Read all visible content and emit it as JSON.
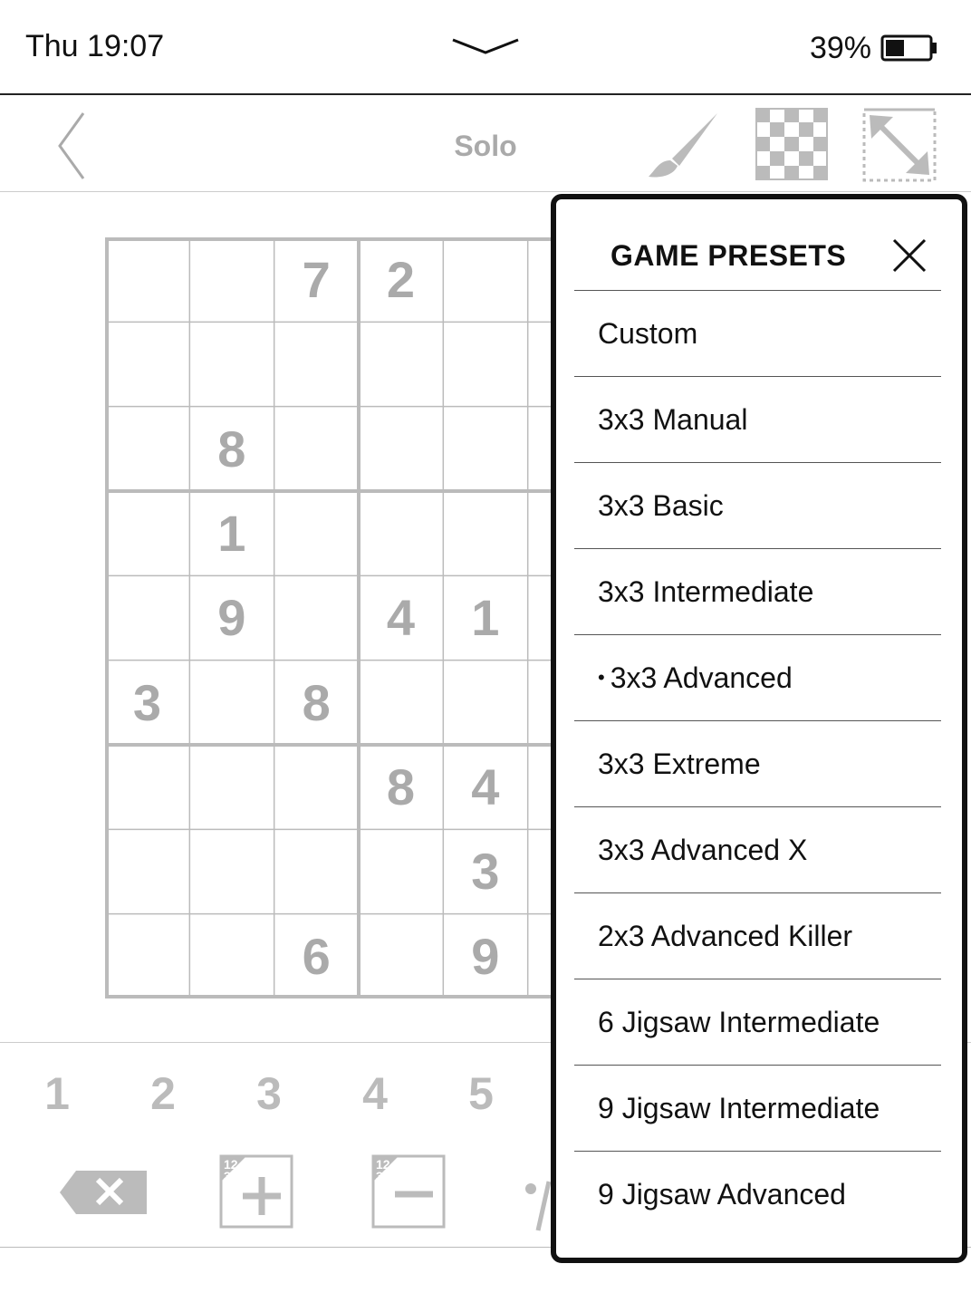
{
  "status": {
    "time": "Thu 19:07",
    "battery": "39%"
  },
  "toolbar": {
    "title": "Solo"
  },
  "board": {
    "cells": [
      {
        "r": 0,
        "c": 2,
        "v": "7"
      },
      {
        "r": 0,
        "c": 3,
        "v": "2"
      },
      {
        "r": 2,
        "c": 1,
        "v": "8"
      },
      {
        "r": 3,
        "c": 1,
        "v": "1"
      },
      {
        "r": 4,
        "c": 1,
        "v": "9"
      },
      {
        "r": 4,
        "c": 3,
        "v": "4"
      },
      {
        "r": 4,
        "c": 4,
        "v": "1"
      },
      {
        "r": 5,
        "c": 0,
        "v": "3"
      },
      {
        "r": 5,
        "c": 2,
        "v": "8"
      },
      {
        "r": 6,
        "c": 3,
        "v": "8"
      },
      {
        "r": 6,
        "c": 4,
        "v": "4"
      },
      {
        "r": 7,
        "c": 4,
        "v": "3"
      },
      {
        "r": 8,
        "c": 2,
        "v": "6"
      },
      {
        "r": 8,
        "c": 4,
        "v": "9"
      }
    ]
  },
  "numbers": [
    "1",
    "2",
    "3",
    "4",
    "5"
  ],
  "tools": {
    "note_label": "12\n3"
  },
  "panel": {
    "title": "GAME PRESETS",
    "selected_index": 4,
    "presets": [
      "Custom",
      "3x3 Manual",
      "3x3 Basic",
      "3x3 Intermediate",
      "3x3 Advanced",
      "3x3 Extreme",
      "3x3 Advanced X",
      "2x3 Advanced Killer",
      "6 Jigsaw Intermediate",
      "9 Jigsaw Intermediate",
      "9 Jigsaw Advanced"
    ]
  }
}
